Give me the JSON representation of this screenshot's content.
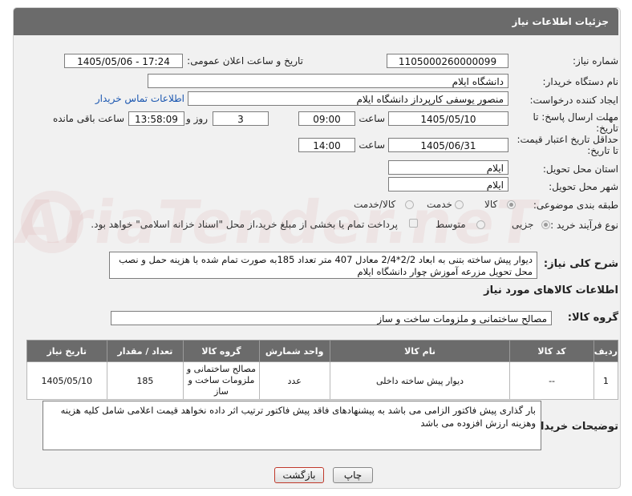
{
  "header": {
    "title": "جزئیات اطلاعات نیاز"
  },
  "form": {
    "need_number_label": "شماره نیاز:",
    "need_number": "1105000260000099",
    "announce_label": "تاریخ و ساعت اعلان عمومی:",
    "announce_value": "1405/05/06 - 17:24",
    "buyer_org_label": "نام دستگاه خریدار:",
    "buyer_org": "دانشگاه ایلام",
    "creator_label": "ایجاد کننده درخواست:",
    "creator": "منصور یوسفی کارپرداز دانشگاه ایلام",
    "contact_link": "اطلاعات تماس خریدار",
    "deadline_label": "مهلت ارسال پاسخ: تا تاریخ:",
    "deadline_date": "1405/05/10",
    "time_label": "ساعت",
    "deadline_time": "09:00",
    "days_value": "3",
    "days_label": "روز و",
    "remaining_time": "13:58:09",
    "remaining_label": "ساعت باقی مانده",
    "validity_label": "حداقل تاریخ اعتبار قیمت: تا تاریخ:",
    "validity_date": "1405/06/31",
    "validity_time_label": "ساعت",
    "validity_time": "14:00",
    "province_label": "استان محل تحویل:",
    "province": "ایلام",
    "city_label": "شهر محل تحویل:",
    "city": "ایلام",
    "category_label": "طبقه بندی موضوعی:",
    "category_options": [
      "کالا",
      "خدمت",
      "کالا/خدمت"
    ],
    "process_label": "نوع فرآیند خرید :",
    "process_options": [
      "جزیی",
      "متوسط"
    ],
    "payment_note": "پرداخت تمام یا بخشی از مبلغ خرید،از محل \"اسناد خزانه اسلامی\" خواهد بود."
  },
  "description": {
    "label": "شرح کلی نیاز:",
    "text": "دیوار پیش ساخته  بتنی به ابعاد 2/2*2/4   معادل 407 متر تعداد 185به صورت تمام شده با هزینه حمل و نصب محل تحویل مزرعه آموزش چوار دانشگاه ایلام"
  },
  "goods": {
    "section_title": "اطلاعات کالاهای مورد نیاز",
    "group_label": "گروه کالا:",
    "group_value": "مصالح ساختمانی و ملزومات ساخت و ساز",
    "columns": [
      "ردیف",
      "کد کالا",
      "نام کالا",
      "واحد شمارش",
      "گروه کالا",
      "تعداد / مقدار",
      "تاریخ نیاز"
    ],
    "rows": [
      [
        "1",
        "--",
        "دیوار پیش ساخته داخلی",
        "عدد",
        "مصالح ساختمانی و ملزومات ساخت و ساز",
        "185",
        "1405/05/10"
      ]
    ]
  },
  "buyer_notes": {
    "label": "توضیحات خریدار:",
    "text": "بار گذاری پیش فاکتور الزامی می باشد به پیشنهادهای فاقد پیش فاکتور ترتیب اثر داده نخواهد قیمت اعلامی شامل کلیه هزینه وهزینه ارزش افزوده می باشد"
  },
  "buttons": {
    "print": "چاپ",
    "back": "بازگشت"
  },
  "watermark": "AriaTender.neT",
  "colors": {
    "header": "#6b6b6b",
    "link": "#1a56b0",
    "back_button_border": "#c0392b"
  }
}
